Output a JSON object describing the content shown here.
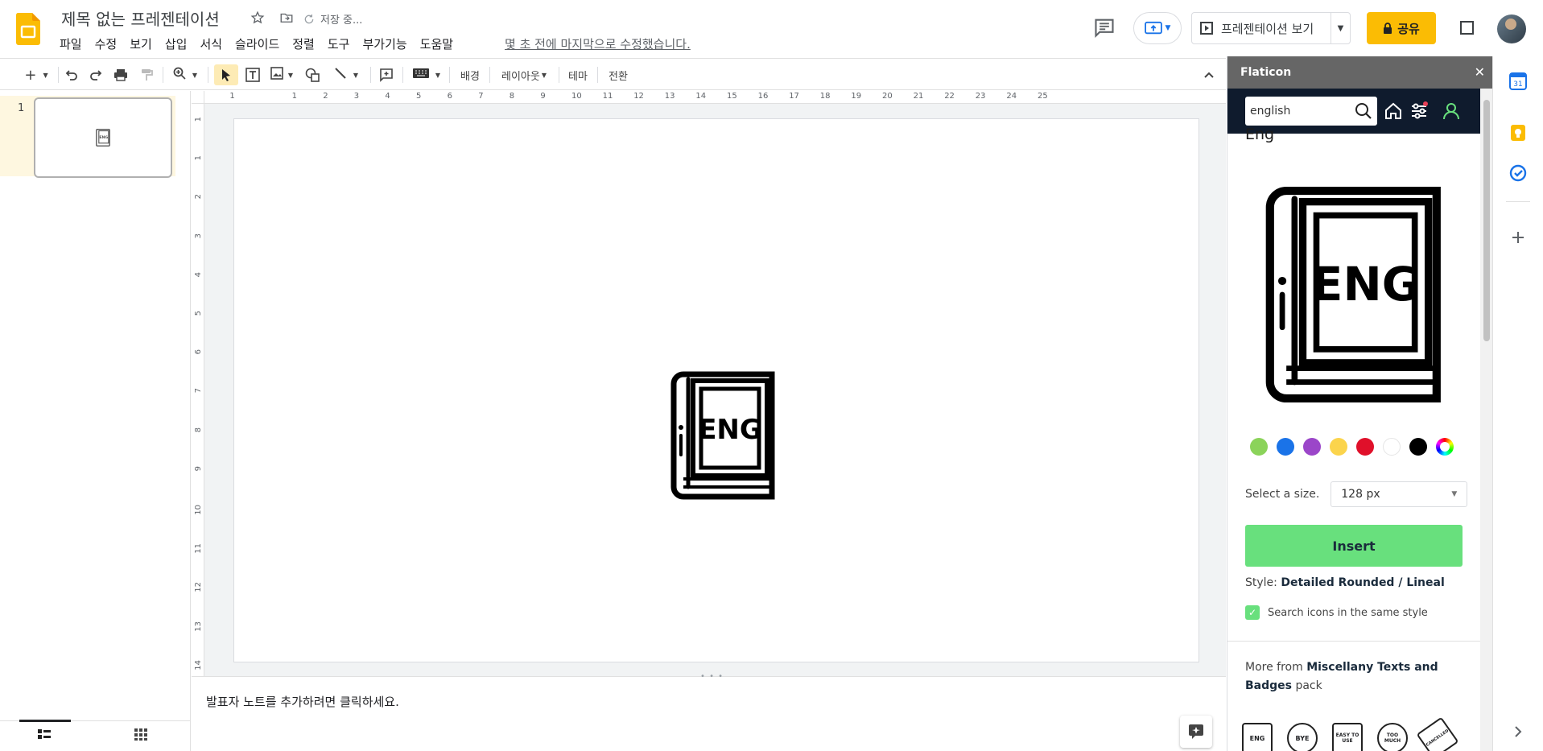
{
  "app": {
    "title": "제목 없는 프레젠테이션",
    "saving": "저장 중...",
    "last_edit": "몇 초 전에 마지막으로 수정했습니다.",
    "menu": [
      "파일",
      "수정",
      "보기",
      "삽입",
      "서식",
      "슬라이드",
      "정렬",
      "도구",
      "부가기능",
      "도움말"
    ],
    "present_label": "프레젠테이션 보기",
    "share_label": "공유"
  },
  "toolbar": {
    "background": "배경",
    "layout": "레이아웃",
    "theme": "테마",
    "transition": "전환"
  },
  "filmstrip": {
    "slide_number": "1"
  },
  "slide": {
    "icon_text": "ENG"
  },
  "rulers": {
    "horizontal": [
      "1",
      "1",
      "2",
      "3",
      "4",
      "5",
      "6",
      "7",
      "8",
      "9",
      "10",
      "11",
      "12",
      "13",
      "14",
      "15",
      "16",
      "17",
      "18",
      "19",
      "20",
      "21",
      "22",
      "23",
      "24",
      "25"
    ],
    "vertical": [
      "1",
      "1",
      "2",
      "3",
      "4",
      "5",
      "6",
      "7",
      "8",
      "9",
      "10",
      "11",
      "12",
      "13",
      "14"
    ]
  },
  "notes": {
    "placeholder": "발표자 노트를 추가하려면 클릭하세요."
  },
  "flaticon": {
    "header": "Flaticon",
    "search_value": "english",
    "icon_name": "Eng",
    "icon_text": "ENG",
    "colors": [
      "#8bd35a",
      "#1a73e8",
      "#9b46c9",
      "#fbd44c",
      "#e0102a",
      "#ffffff",
      "#000000",
      "rainbow"
    ],
    "size_label": "Select a size.",
    "size_value": "128 px",
    "insert_label": "Insert",
    "style_prefix": "Style:",
    "style_value": "Detailed Rounded / Lineal",
    "same_style_label": "Search icons in the same style",
    "more_from_prefix": "More from",
    "more_from_pack": "Miscellany Texts and Badges",
    "more_from_suffix": "pack",
    "pack_icons": [
      "ENG",
      "BYE",
      "EASY TO USE",
      "TOO MUCH",
      "CANCELLED"
    ]
  },
  "colors": {
    "share_yellow": "#fbbc04",
    "insert_green": "#68e07d",
    "flaticon_navy": "#0f1b2d",
    "thumb_selected": "#fef7e0"
  }
}
